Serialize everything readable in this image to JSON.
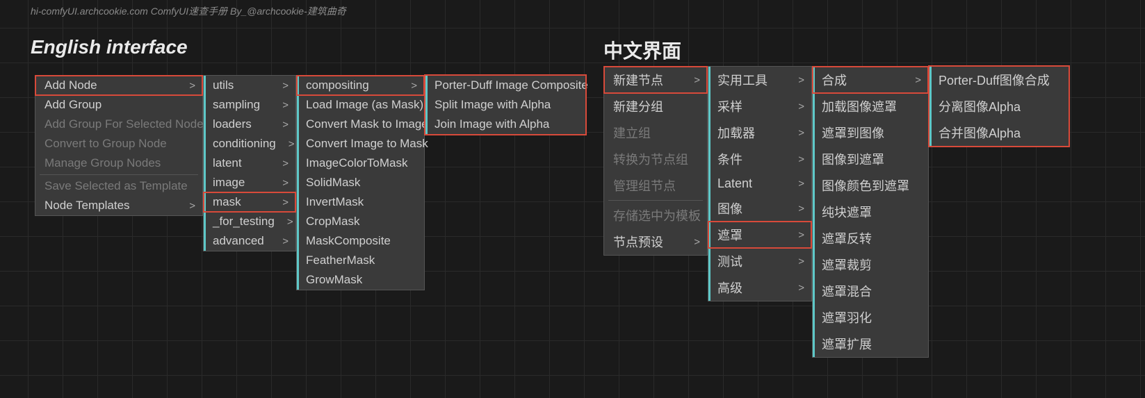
{
  "watermark": "hi-comfyUI.archcookie.com ComfyUI速查手册 By_@archcookie-建筑曲奇",
  "titles": {
    "en": "English interface",
    "cn": "中文界面"
  },
  "arrow": ">",
  "en": {
    "m1": [
      {
        "label": "Add Node",
        "arrow": true,
        "hl": true
      },
      {
        "label": "Add Group"
      },
      {
        "label": "Add Group For Selected Nodes",
        "disabled": true
      },
      {
        "label": "Convert to Group Node",
        "disabled": true
      },
      {
        "label": "Manage Group Nodes",
        "disabled": true
      },
      {
        "hr": true
      },
      {
        "label": "Save Selected as Template",
        "disabled": true
      },
      {
        "label": "Node Templates",
        "arrow": true
      }
    ],
    "m2": [
      {
        "label": "utils",
        "arrow": true,
        "teal": true
      },
      {
        "label": "sampling",
        "arrow": true,
        "teal": true
      },
      {
        "label": "loaders",
        "arrow": true,
        "teal": true
      },
      {
        "label": "conditioning",
        "arrow": true,
        "teal": true
      },
      {
        "label": "latent",
        "arrow": true,
        "teal": true
      },
      {
        "label": "image",
        "arrow": true,
        "teal": true
      },
      {
        "label": "mask",
        "arrow": true,
        "teal": true,
        "hl": true
      },
      {
        "label": "_for_testing",
        "arrow": true,
        "teal": true
      },
      {
        "label": "advanced",
        "arrow": true,
        "teal": true
      }
    ],
    "m3": [
      {
        "label": "compositing",
        "arrow": true,
        "teal": true,
        "hl": true
      },
      {
        "label": "Load Image (as Mask)",
        "teal": true
      },
      {
        "label": "Convert Mask to Image",
        "teal": true
      },
      {
        "label": "Convert Image to Mask",
        "teal": true
      },
      {
        "label": "ImageColorToMask",
        "teal": true
      },
      {
        "label": "SolidMask",
        "teal": true
      },
      {
        "label": "InvertMask",
        "teal": true
      },
      {
        "label": "CropMask",
        "teal": true
      },
      {
        "label": "MaskComposite",
        "teal": true
      },
      {
        "label": "FeatherMask",
        "teal": true
      },
      {
        "label": "GrowMask",
        "teal": true
      }
    ],
    "m4": [
      {
        "label": "Porter-Duff Image Composite",
        "teal": true
      },
      {
        "label": "Split Image with Alpha",
        "teal": true
      },
      {
        "label": "Join Image with Alpha",
        "teal": true
      }
    ]
  },
  "cn": {
    "m1": [
      {
        "label": "新建节点",
        "arrow": true,
        "hl": true
      },
      {
        "label": "新建分组"
      },
      {
        "label": "建立组",
        "disabled": true
      },
      {
        "label": "转换为节点组",
        "disabled": true
      },
      {
        "label": "管理组节点",
        "disabled": true
      },
      {
        "hr": true
      },
      {
        "label": "存储选中为模板",
        "disabled": true
      },
      {
        "label": "节点预设",
        "arrow": true
      }
    ],
    "m2": [
      {
        "label": "实用工具",
        "arrow": true,
        "teal": true
      },
      {
        "label": "采样",
        "arrow": true,
        "teal": true
      },
      {
        "label": "加载器",
        "arrow": true,
        "teal": true
      },
      {
        "label": "条件",
        "arrow": true,
        "teal": true
      },
      {
        "label": "Latent",
        "arrow": true,
        "teal": true
      },
      {
        "label": "图像",
        "arrow": true,
        "teal": true
      },
      {
        "label": "遮罩",
        "arrow": true,
        "teal": true,
        "hl": true
      },
      {
        "label": "测试",
        "arrow": true,
        "teal": true
      },
      {
        "label": "高级",
        "arrow": true,
        "teal": true
      }
    ],
    "m3": [
      {
        "label": "合成",
        "arrow": true,
        "teal": true,
        "hl": true
      },
      {
        "label": "加载图像遮罩",
        "teal": true
      },
      {
        "label": "遮罩到图像",
        "teal": true
      },
      {
        "label": "图像到遮罩",
        "teal": true
      },
      {
        "label": "图像颜色到遮罩",
        "teal": true
      },
      {
        "label": "纯块遮罩",
        "teal": true
      },
      {
        "label": "遮罩反转",
        "teal": true
      },
      {
        "label": "遮罩裁剪",
        "teal": true
      },
      {
        "label": "遮罩混合",
        "teal": true
      },
      {
        "label": "遮罩羽化",
        "teal": true
      },
      {
        "label": "遮罩扩展",
        "teal": true
      }
    ],
    "m4": [
      {
        "label": "Porter-Duff图像合成",
        "teal": true
      },
      {
        "label": "分离图像Alpha",
        "teal": true
      },
      {
        "label": "合并图像Alpha",
        "teal": true
      }
    ]
  }
}
